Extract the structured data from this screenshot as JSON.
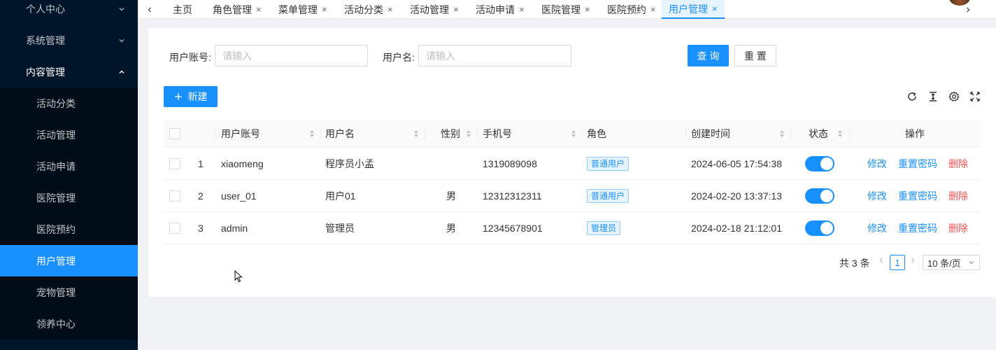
{
  "sidebar": {
    "top_items": [
      {
        "label": "个人中心",
        "icon": "chevron-down-icon"
      },
      {
        "label": "系统管理",
        "icon": "chevron-down-icon"
      },
      {
        "label": "内容管理",
        "icon": "chevron-up-icon"
      }
    ],
    "sub_items": [
      {
        "label": "活动分类"
      },
      {
        "label": "活动管理"
      },
      {
        "label": "活动申请"
      },
      {
        "label": "医院管理"
      },
      {
        "label": "医院预约"
      },
      {
        "label": "用户管理"
      },
      {
        "label": "宠物管理"
      },
      {
        "label": "领养中心"
      }
    ],
    "active_sub": "用户管理"
  },
  "tabs": [
    {
      "label": "主页",
      "closable": false
    },
    {
      "label": "角色管理",
      "closable": true
    },
    {
      "label": "菜单管理",
      "closable": true
    },
    {
      "label": "活动分类",
      "closable": true
    },
    {
      "label": "活动管理",
      "closable": true
    },
    {
      "label": "活动申请",
      "closable": true
    },
    {
      "label": "医院管理",
      "closable": true
    },
    {
      "label": "医院预约",
      "closable": true
    },
    {
      "label": "用户管理",
      "closable": true,
      "active": true
    }
  ],
  "tab_close_glyph": "×",
  "search": {
    "account_label": "用户账号:",
    "account_placeholder": "请输入",
    "name_label": "用户名:",
    "name_placeholder": "请输入",
    "query_button": "查 询",
    "reset_button": "重 置"
  },
  "toolbar": {
    "new_button": "新建",
    "new_icon": "plus-icon",
    "icons": [
      "reload-icon",
      "column-height-icon",
      "setting-icon",
      "fullscreen-icon"
    ]
  },
  "table": {
    "columns": [
      "",
      "",
      "用户账号",
      "用户名",
      "性别",
      "手机号",
      "角色",
      "创建时间",
      "状态",
      "操作"
    ],
    "rows": [
      {
        "index": "1",
        "account": "xiaomeng",
        "name": "程序员小孟",
        "gender": "",
        "phone": "1319089098",
        "role": "普通用户",
        "created": "2024-06-05 17:54:38",
        "enabled": true
      },
      {
        "index": "2",
        "account": "user_01",
        "name": "用户01",
        "gender": "男",
        "phone": "12312312311",
        "role": "普通用户",
        "created": "2024-02-20 13:37:13",
        "enabled": true
      },
      {
        "index": "3",
        "account": "admin",
        "name": "管理员",
        "gender": "男",
        "phone": "12345678901",
        "role": "管理员",
        "created": "2024-02-18 21:12:01",
        "enabled": true
      }
    ],
    "actions": {
      "edit": "修改",
      "reset_password": "重置密码",
      "delete": "删除"
    }
  },
  "pagination": {
    "total_text": "共 3 条",
    "current_page": "1",
    "page_size": "10 条/页"
  },
  "colors": {
    "primary": "#1890ff",
    "danger": "#ff4d4f",
    "sidebar_bg": "#001529"
  }
}
